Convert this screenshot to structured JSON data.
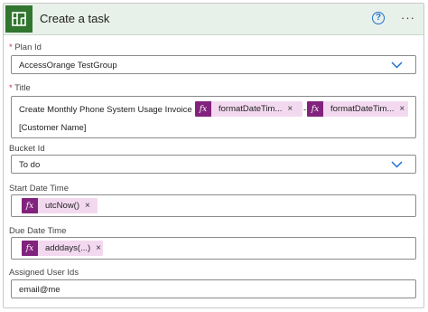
{
  "header": {
    "title": "Create a task",
    "app_icon": "planner-icon",
    "help_icon": "help-icon",
    "more_icon": "more-options-icon",
    "more_glyph": "···",
    "help_glyph": "?"
  },
  "colors": {
    "header_bg": "#e8f1e9",
    "app_icon_bg": "#31752f",
    "expression_token_bg": "#f3d9f0",
    "expression_icon_bg": "#81237d",
    "required": "#c4314b",
    "dropdown_chevron": "#1f6fd1"
  },
  "fields": {
    "plan_id": {
      "label": "Plan Id",
      "required_mark": "*",
      "value": "AccessOrange TestGroup"
    },
    "title": {
      "label": "Title",
      "required_mark": "*",
      "text_before": "Create Monthly Phone System Usage Invoice",
      "separator": "-",
      "tokens": [
        {
          "icon": "fx",
          "text": "formatDateTim...",
          "remove": "×"
        },
        {
          "icon": "fx",
          "text": "formatDateTim...",
          "remove": "×"
        }
      ],
      "text_after": "[Customer Name]"
    },
    "bucket_id": {
      "label": "Bucket Id",
      "value": "To do"
    },
    "start_date_time": {
      "label": "Start Date Time",
      "token": {
        "icon": "fx",
        "text": "utcNow()",
        "remove": "×"
      }
    },
    "due_date_time": {
      "label": "Due Date Time",
      "token": {
        "icon": "fx",
        "text": "adddays(...)",
        "remove": "×"
      }
    },
    "assigned_user_ids": {
      "label": "Assigned User Ids",
      "value": "email@me"
    }
  }
}
